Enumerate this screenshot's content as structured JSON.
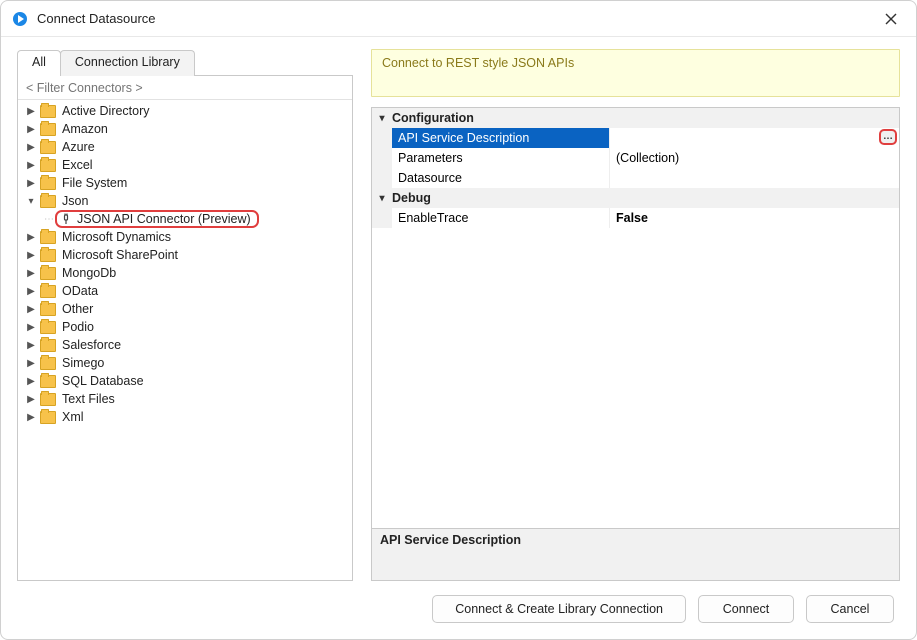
{
  "window": {
    "title": "Connect Datasource"
  },
  "tabs": {
    "all": "All",
    "library": "Connection Library"
  },
  "filter": {
    "placeholder": "< Filter Connectors >"
  },
  "tree": {
    "items": [
      {
        "label": "Active Directory"
      },
      {
        "label": "Amazon"
      },
      {
        "label": "Azure"
      },
      {
        "label": "Excel"
      },
      {
        "label": "File System"
      },
      {
        "label": "Json",
        "expanded": true
      },
      {
        "label": "Microsoft Dynamics"
      },
      {
        "label": "Microsoft SharePoint"
      },
      {
        "label": "MongoDb"
      },
      {
        "label": "OData"
      },
      {
        "label": "Other"
      },
      {
        "label": "Podio"
      },
      {
        "label": "Salesforce"
      },
      {
        "label": "Simego"
      },
      {
        "label": "SQL Database"
      },
      {
        "label": "Text Files"
      },
      {
        "label": "Xml"
      }
    ],
    "json_child": "JSON API Connector (Preview)"
  },
  "banner": {
    "text": "Connect to REST style JSON APIs"
  },
  "props": {
    "cat_config": "Configuration",
    "cat_debug": "Debug",
    "rows": {
      "api_desc": {
        "name": "API Service Description",
        "value": ""
      },
      "params": {
        "name": "Parameters",
        "value": "(Collection)"
      },
      "datasource": {
        "name": "Datasource",
        "value": ""
      },
      "enable_trace": {
        "name": "EnableTrace",
        "value": "False"
      }
    },
    "desc_title": "API Service Description"
  },
  "buttons": {
    "create_lib": "Connect & Create Library Connection",
    "connect": "Connect",
    "cancel": "Cancel"
  }
}
